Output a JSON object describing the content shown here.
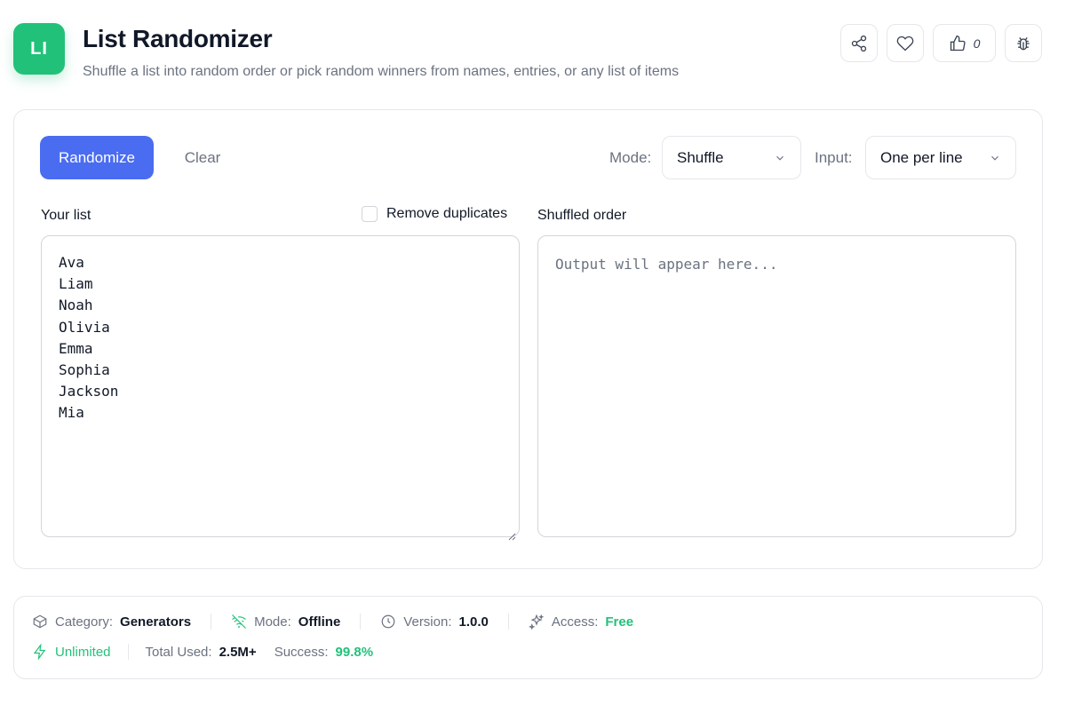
{
  "header": {
    "logo_text": "LI",
    "title": "List Randomizer",
    "subtitle": "Shuffle a list into random order or pick random winners from names, entries, or any list of items",
    "like_count": "0"
  },
  "toolbar": {
    "randomize_label": "Randomize",
    "clear_label": "Clear",
    "mode_label": "Mode:",
    "mode_value": "Shuffle",
    "input_label": "Input:",
    "input_value": "One per line"
  },
  "input_panel": {
    "label": "Your list",
    "remove_duplicates_label": "Remove duplicates",
    "items": [
      "Ava",
      "Liam",
      "Noah",
      "Olivia",
      "Emma",
      "Sophia",
      "Jackson",
      "Mia"
    ]
  },
  "output_panel": {
    "label": "Shuffled order",
    "placeholder": "Output will appear here..."
  },
  "info": {
    "category_label": "Category:",
    "category_value": "Generators",
    "mode_label": "Mode:",
    "mode_value": "Offline",
    "version_label": "Version:",
    "version_value": "1.0.0",
    "access_label": "Access:",
    "access_value": "Free",
    "unlimited_label": "Unlimited",
    "total_used_label": "Total Used:",
    "total_used_value": "2.5M+",
    "success_label": "Success:",
    "success_value": "99.8%"
  },
  "colors": {
    "accent": "#4a6cf0",
    "brand_green": "#22c17a"
  },
  "icons": [
    "share-icon",
    "heart-icon",
    "thumbs-up-icon",
    "bug-icon",
    "chevron-down-icon",
    "box-icon",
    "wifi-off-icon",
    "clock-icon",
    "sparkles-icon",
    "zap-icon"
  ]
}
